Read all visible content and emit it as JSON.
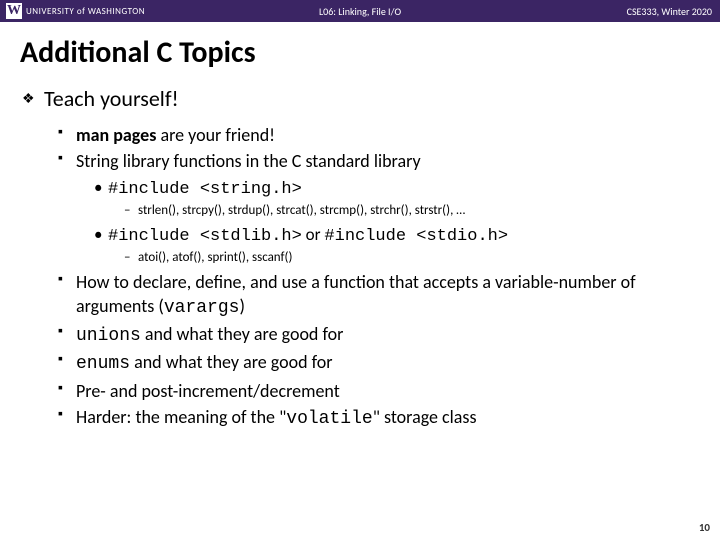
{
  "header": {
    "logo_text": "UNIVERSITY of WASHINGTON",
    "center": "L06: Linking, File I/O",
    "right": "CSE333, Winter 2020"
  },
  "title": "Additional C Topics",
  "teach_label": "Teach yourself!",
  "b1_strong": "man pages",
  "b1_rest": " are your friend!",
  "b2": "String library functions in the C standard library",
  "inc1": "#include <string.h>",
  "fns1": "strlen(), strcpy(), strdup(), strcat(), strcmp(), strchr(), strstr(), …",
  "inc2a": "#include <stdlib.h>",
  "inc2_or": " or ",
  "inc2b": "#include <stdio.h>",
  "fns2": "atoi(), atof(), sprint(), sscanf()",
  "b3a": "How to declare, define, and use a function that accepts a variable-number of arguments (",
  "b3code": "varargs",
  "b3b": ")",
  "b4code": "unions",
  "b4rest": " and what they are good for",
  "b5code": "enums",
  "b5rest": " and what they are good for",
  "b6": "Pre- and post-increment/decrement",
  "b7a": "Harder: the meaning of the \"",
  "b7code": "volatile",
  "b7b": "\" storage class",
  "page_num": "10"
}
